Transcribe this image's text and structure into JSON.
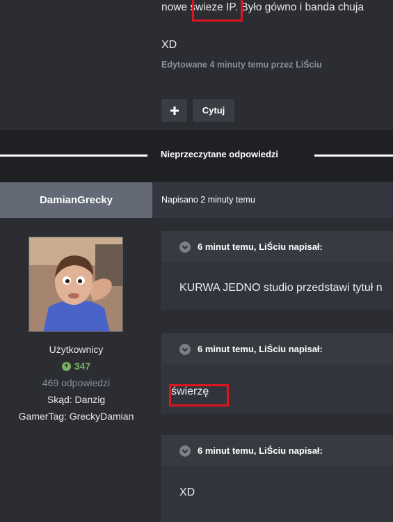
{
  "top_post": {
    "text_before": "nowe ",
    "text_highlight": "świeze",
    "text_after": " IP. Było gówno i banda chuja",
    "xd": "XD",
    "edited": "Edytowane 4 minuty temu przez LiŚciu",
    "plus_icon": "plus-icon",
    "quote_button": "Cytuj"
  },
  "separator": {
    "label": "Nieprzeczytane odpowiedzi"
  },
  "post": {
    "author": "DamianGrecky",
    "posted": "Napisano 2 minuty temu",
    "author_info": {
      "group": "Użytkownicy",
      "reputation": "347",
      "replies": "469 odpowiedzi",
      "location": "Skąd: Danzig",
      "gamertag": "GamerTag: GreckyDamian"
    },
    "quotes": [
      {
        "title": "6 minut temu, LiŚciu napisał:",
        "body": "KURWA JEDNO studio przedstawi tytuł n"
      },
      {
        "title": "6 minut temu, LiŚciu napisał:",
        "body": "świerzę"
      },
      {
        "title": "6 minut temu, LiŚciu napisał:",
        "body": "XD"
      }
    ]
  },
  "colors": {
    "highlight_box": "#e0141e",
    "reputation": "#7ab35e",
    "background": "#2b2d33"
  }
}
